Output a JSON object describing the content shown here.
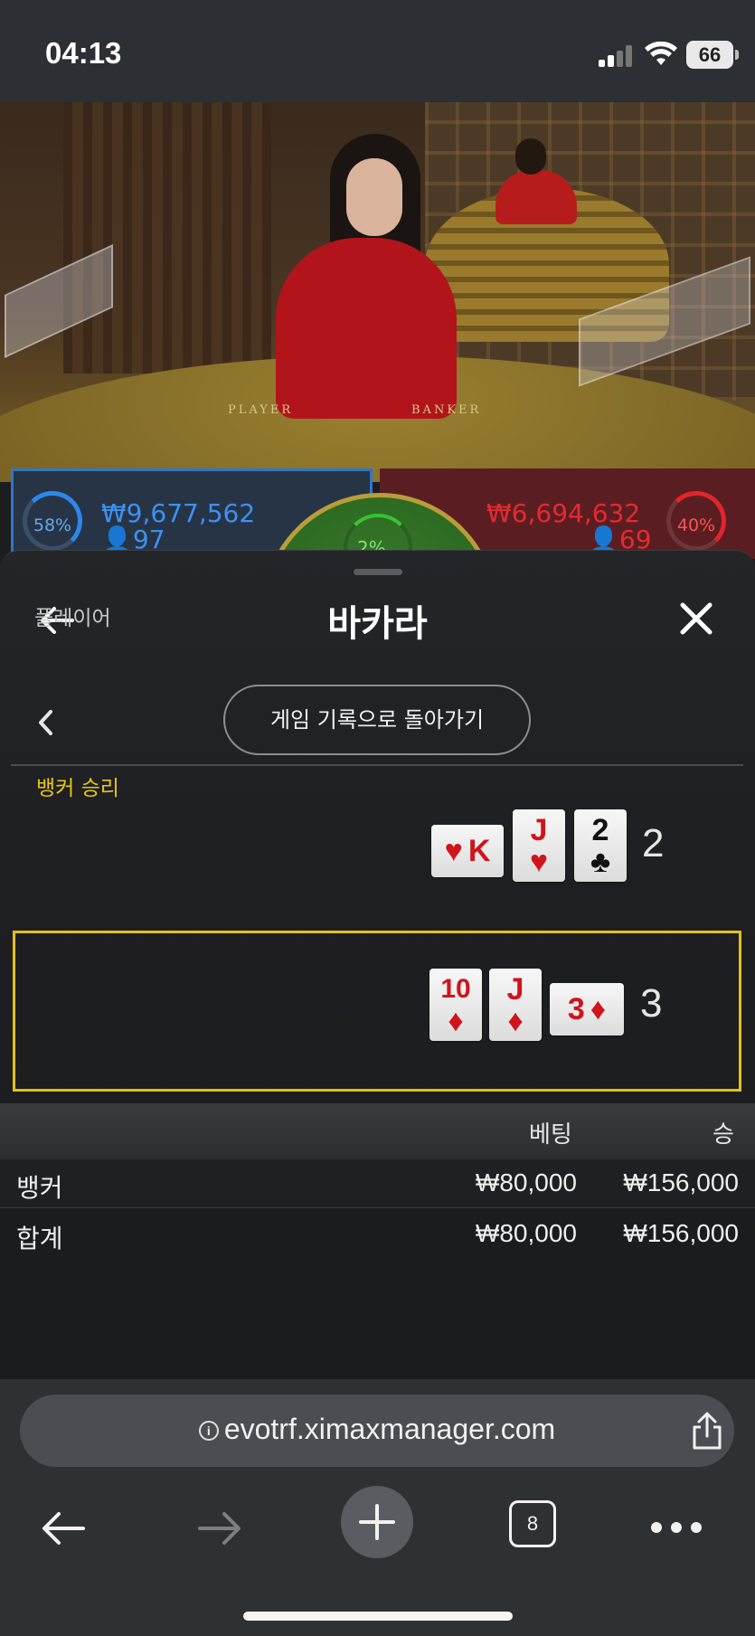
{
  "status_bar": {
    "time": "04:13",
    "battery": "66"
  },
  "video": {
    "table_text_player": "PLAYER",
    "table_text_banker": "BANKER",
    "player_bets": {
      "percent": "58%",
      "amount": "₩9,677,562",
      "count": "97"
    },
    "banker_bets": {
      "percent": "40%",
      "amount": "₩6,694,632",
      "count": "69"
    },
    "tie_bets": {
      "percent": "2%"
    }
  },
  "sheet": {
    "title": "바카라",
    "history_button": "게임 기록으로 돌아가기",
    "player": {
      "label": "플레이어",
      "score": "2",
      "cards": [
        {
          "rank": "K",
          "suit": "♥",
          "color": "red",
          "orientation": "sideways"
        },
        {
          "rank": "J",
          "suit": "♥",
          "color": "red",
          "orientation": "upright"
        },
        {
          "rank": "2",
          "suit": "♣",
          "color": "black",
          "orientation": "upright"
        }
      ]
    },
    "banker": {
      "label": "뱅커 승리",
      "score": "3",
      "cards": [
        {
          "rank": "10",
          "suit": "♦",
          "color": "red",
          "orientation": "upright"
        },
        {
          "rank": "J",
          "suit": "♦",
          "color": "red",
          "orientation": "upright"
        },
        {
          "rank": "3",
          "suit": "♦",
          "color": "red",
          "orientation": "sideways"
        }
      ]
    },
    "bets_table": {
      "col_bet": "베팅",
      "col_win": "승",
      "rows": [
        {
          "name": "뱅커",
          "bet": "₩80,000",
          "win": "₩156,000"
        },
        {
          "name": "합계",
          "bet": "₩80,000",
          "win": "₩156,000"
        }
      ]
    }
  },
  "browser": {
    "url": "evotrf.ximaxmanager.com",
    "tab_count": "8"
  },
  "colors": {
    "player_blue": "#3c91f2",
    "banker_red": "#e52a2f",
    "winner_highlight": "#e3c115",
    "tie_green": "#39c235"
  }
}
